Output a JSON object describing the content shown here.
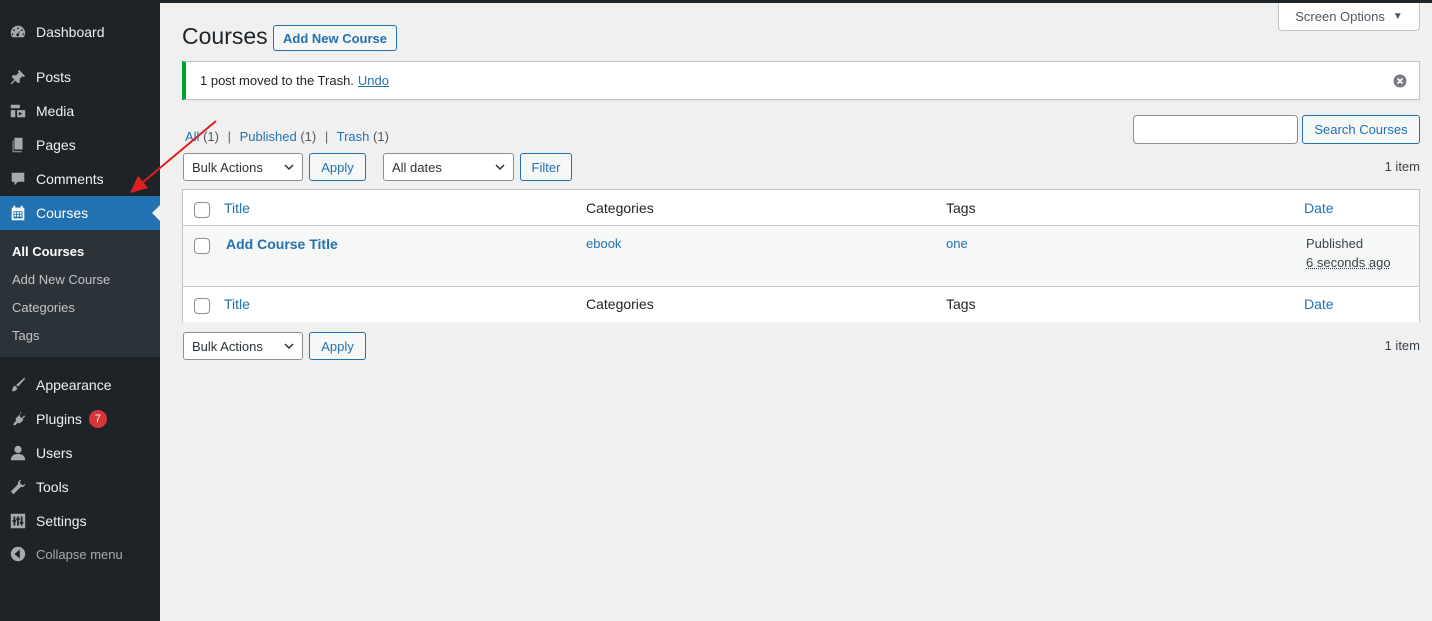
{
  "sidebar": {
    "items": [
      {
        "label": "Dashboard",
        "icon": "dashboard-icon"
      },
      {
        "label": "Posts",
        "icon": "pushpin-icon"
      },
      {
        "label": "Media",
        "icon": "media-icon"
      },
      {
        "label": "Pages",
        "icon": "pages-icon"
      },
      {
        "label": "Comments",
        "icon": "comment-icon"
      },
      {
        "label": "Courses",
        "icon": "calendar-icon",
        "current": true
      },
      {
        "label": "Appearance",
        "icon": "paintbrush-icon"
      },
      {
        "label": "Plugins",
        "icon": "plug-icon",
        "badge": "7"
      },
      {
        "label": "Users",
        "icon": "user-icon"
      },
      {
        "label": "Tools",
        "icon": "wrench-icon"
      },
      {
        "label": "Settings",
        "icon": "settings-sliders-icon"
      }
    ],
    "submenu": [
      {
        "label": "All Courses",
        "current": true
      },
      {
        "label": "Add New Course"
      },
      {
        "label": "Categories"
      },
      {
        "label": "Tags"
      }
    ],
    "collapse_label": "Collapse menu",
    "accent_color": "#2271b1",
    "background_color": "#1d2327",
    "badge_color": "#d63638"
  },
  "header": {
    "screen_options_label": "Screen Options",
    "title": "Courses",
    "add_new_label": "Add New Course"
  },
  "notice": {
    "message": "1 post moved to the Trash.",
    "undo_label": "Undo",
    "border_color": "#00a32a"
  },
  "views": {
    "all_label": "All",
    "all_count": "(1)",
    "published_label": "Published",
    "published_count": "(1)",
    "trash_label": "Trash",
    "trash_count": "(1)",
    "separator": "|"
  },
  "search": {
    "value": "",
    "button_label": "Search Courses"
  },
  "tablenav_top": {
    "bulk_actions_value": "Bulk Actions",
    "apply_label": "Apply",
    "dates_value": "All dates",
    "filter_label": "Filter",
    "item_count": "1 item"
  },
  "table": {
    "columns": {
      "title": "Title",
      "categories": "Categories",
      "tags": "Tags",
      "date": "Date"
    },
    "rows": [
      {
        "title": "Add Course Title",
        "categories": "ebook",
        "tags": "one",
        "date_status": "Published",
        "date_ago": "6 seconds ago"
      }
    ]
  },
  "tablenav_bottom": {
    "bulk_actions_value": "Bulk Actions",
    "apply_label": "Apply",
    "item_count": "1 item"
  },
  "annotation": {
    "arrow_color": "#e02020"
  }
}
